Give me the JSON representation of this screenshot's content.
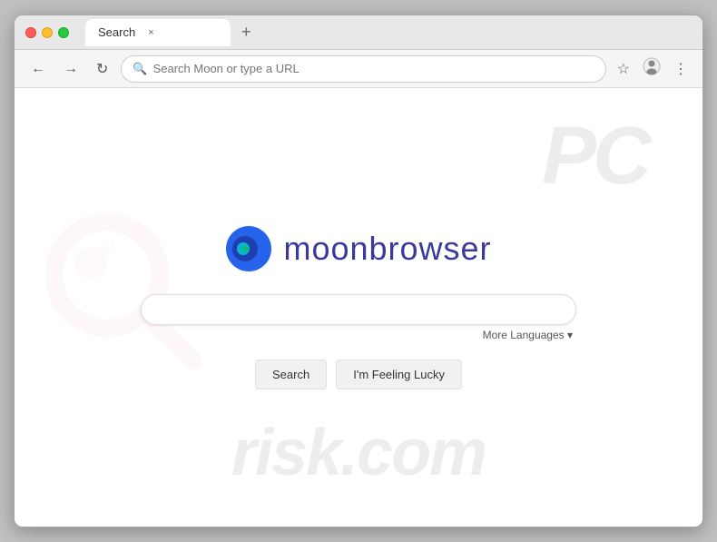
{
  "browser": {
    "tab_title": "Search",
    "tab_close_label": "×",
    "new_tab_label": "+",
    "address_bar_placeholder": "Search Moon or type a URL",
    "address_bar_value": "",
    "nav": {
      "back_label": "←",
      "forward_label": "→",
      "refresh_label": "↻"
    }
  },
  "page": {
    "logo_text": "moonbrowser",
    "search_input_placeholder": "",
    "more_languages_label": "More Languages ▾",
    "search_button_label": "Search",
    "lucky_button_label": "I'm Feeling Lucky"
  },
  "watermark": {
    "top_text": "PC",
    "bottom_text": "risk.com"
  }
}
